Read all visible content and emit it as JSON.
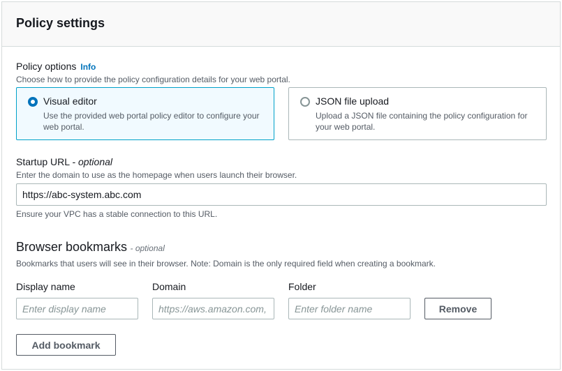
{
  "header": {
    "title": "Policy settings"
  },
  "policy_options": {
    "label": "Policy options",
    "info": "Info",
    "description": "Choose how to provide the policy configuration details for your web portal.",
    "visual": {
      "title": "Visual editor",
      "description": "Use the provided web portal policy editor to configure your web portal.",
      "selected": true
    },
    "json": {
      "title": "JSON file upload",
      "description": "Upload a JSON file containing the policy configuration for your web portal.",
      "selected": false
    }
  },
  "startup_url": {
    "label": "Startup URL",
    "optional": "- optional",
    "description": "Enter the domain to use as the homepage when users launch their browser.",
    "value": "https://abc-system.abc.com",
    "hint": "Ensure your VPC has a stable connection to this URL."
  },
  "bookmarks": {
    "title": "Browser bookmarks",
    "optional": "- optional",
    "description": "Bookmarks that users will see in their browser. Note: Domain is the only required field when creating a bookmark.",
    "display_name_label": "Display name",
    "display_name_placeholder": "Enter display name",
    "domain_label": "Domain",
    "domain_placeholder": "https://aws.amazon.com,",
    "folder_label": "Folder",
    "folder_placeholder": "Enter folder name",
    "remove_label": "Remove",
    "add_label": "Add bookmark"
  },
  "colors": {
    "accent": "#0073bb",
    "selected_border": "#00a1c9",
    "selected_bg": "#f1faff",
    "header_bg": "#f9f9f9"
  }
}
